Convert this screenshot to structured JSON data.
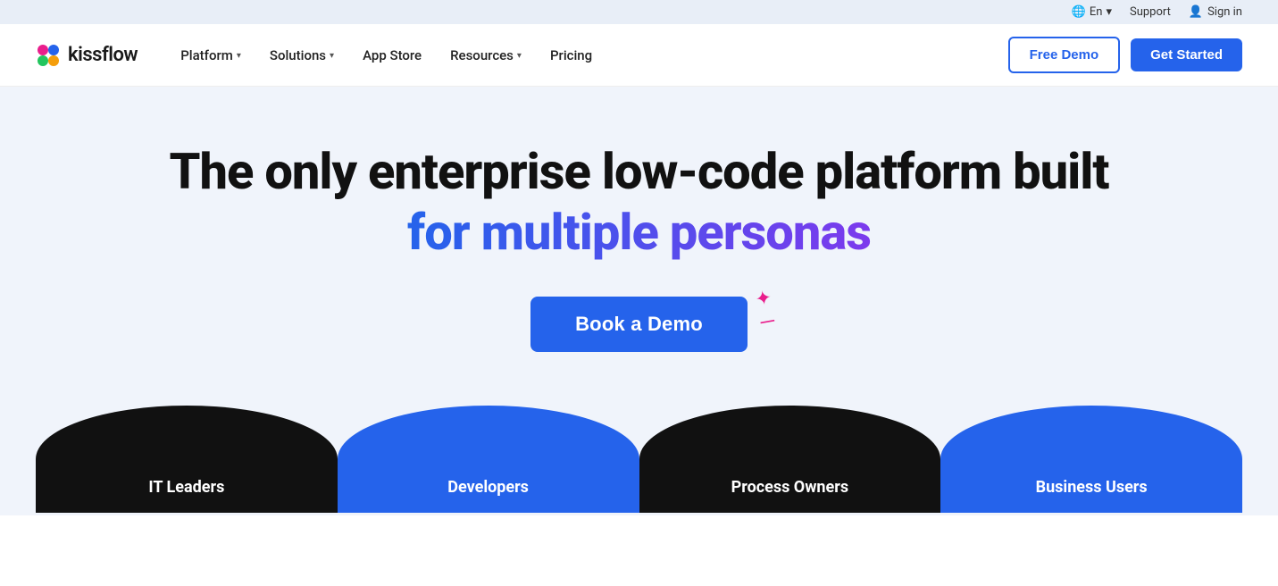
{
  "topbar": {
    "lang": "En",
    "support": "Support",
    "signin": "Sign in"
  },
  "nav": {
    "logo_text": "kissflow",
    "links": [
      {
        "id": "platform",
        "label": "Platform",
        "hasDropdown": true
      },
      {
        "id": "solutions",
        "label": "Solutions",
        "hasDropdown": true
      },
      {
        "id": "appstore",
        "label": "App Store",
        "hasDropdown": false
      },
      {
        "id": "resources",
        "label": "Resources",
        "hasDropdown": true
      },
      {
        "id": "pricing",
        "label": "Pricing",
        "hasDropdown": false
      }
    ],
    "free_demo": "Free Demo",
    "get_started": "Get Started"
  },
  "hero": {
    "title_line1": "The only enterprise low-code platform built",
    "title_line2_plain": "",
    "title_line2_gradient": "for multiple personas",
    "cta_button": "Book a Demo"
  },
  "personas": [
    {
      "id": "it-leaders",
      "label": "IT Leaders",
      "style": "dark"
    },
    {
      "id": "developers",
      "label": "Developers",
      "style": "blue"
    },
    {
      "id": "process-owners",
      "label": "Process Owners",
      "style": "dark"
    },
    {
      "id": "business-users",
      "label": "Business Users",
      "style": "blue"
    }
  ]
}
